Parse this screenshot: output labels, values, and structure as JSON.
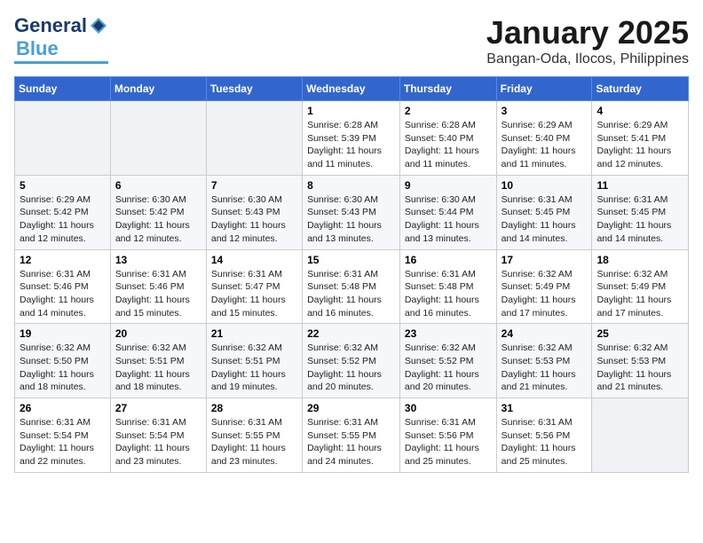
{
  "header": {
    "logo_line1": "General",
    "logo_line2": "Blue",
    "month": "January 2025",
    "location": "Bangan-Oda, Ilocos, Philippines"
  },
  "weekdays": [
    "Sunday",
    "Monday",
    "Tuesday",
    "Wednesday",
    "Thursday",
    "Friday",
    "Saturday"
  ],
  "weeks": [
    [
      {
        "day": "",
        "sunrise": "",
        "sunset": "",
        "daylight": ""
      },
      {
        "day": "",
        "sunrise": "",
        "sunset": "",
        "daylight": ""
      },
      {
        "day": "",
        "sunrise": "",
        "sunset": "",
        "daylight": ""
      },
      {
        "day": "1",
        "sunrise": "Sunrise: 6:28 AM",
        "sunset": "Sunset: 5:39 PM",
        "daylight": "Daylight: 11 hours and 11 minutes."
      },
      {
        "day": "2",
        "sunrise": "Sunrise: 6:28 AM",
        "sunset": "Sunset: 5:40 PM",
        "daylight": "Daylight: 11 hours and 11 minutes."
      },
      {
        "day": "3",
        "sunrise": "Sunrise: 6:29 AM",
        "sunset": "Sunset: 5:40 PM",
        "daylight": "Daylight: 11 hours and 11 minutes."
      },
      {
        "day": "4",
        "sunrise": "Sunrise: 6:29 AM",
        "sunset": "Sunset: 5:41 PM",
        "daylight": "Daylight: 11 hours and 12 minutes."
      }
    ],
    [
      {
        "day": "5",
        "sunrise": "Sunrise: 6:29 AM",
        "sunset": "Sunset: 5:42 PM",
        "daylight": "Daylight: 11 hours and 12 minutes."
      },
      {
        "day": "6",
        "sunrise": "Sunrise: 6:30 AM",
        "sunset": "Sunset: 5:42 PM",
        "daylight": "Daylight: 11 hours and 12 minutes."
      },
      {
        "day": "7",
        "sunrise": "Sunrise: 6:30 AM",
        "sunset": "Sunset: 5:43 PM",
        "daylight": "Daylight: 11 hours and 12 minutes."
      },
      {
        "day": "8",
        "sunrise": "Sunrise: 6:30 AM",
        "sunset": "Sunset: 5:43 PM",
        "daylight": "Daylight: 11 hours and 13 minutes."
      },
      {
        "day": "9",
        "sunrise": "Sunrise: 6:30 AM",
        "sunset": "Sunset: 5:44 PM",
        "daylight": "Daylight: 11 hours and 13 minutes."
      },
      {
        "day": "10",
        "sunrise": "Sunrise: 6:31 AM",
        "sunset": "Sunset: 5:45 PM",
        "daylight": "Daylight: 11 hours and 14 minutes."
      },
      {
        "day": "11",
        "sunrise": "Sunrise: 6:31 AM",
        "sunset": "Sunset: 5:45 PM",
        "daylight": "Daylight: 11 hours and 14 minutes."
      }
    ],
    [
      {
        "day": "12",
        "sunrise": "Sunrise: 6:31 AM",
        "sunset": "Sunset: 5:46 PM",
        "daylight": "Daylight: 11 hours and 14 minutes."
      },
      {
        "day": "13",
        "sunrise": "Sunrise: 6:31 AM",
        "sunset": "Sunset: 5:46 PM",
        "daylight": "Daylight: 11 hours and 15 minutes."
      },
      {
        "day": "14",
        "sunrise": "Sunrise: 6:31 AM",
        "sunset": "Sunset: 5:47 PM",
        "daylight": "Daylight: 11 hours and 15 minutes."
      },
      {
        "day": "15",
        "sunrise": "Sunrise: 6:31 AM",
        "sunset": "Sunset: 5:48 PM",
        "daylight": "Daylight: 11 hours and 16 minutes."
      },
      {
        "day": "16",
        "sunrise": "Sunrise: 6:31 AM",
        "sunset": "Sunset: 5:48 PM",
        "daylight": "Daylight: 11 hours and 16 minutes."
      },
      {
        "day": "17",
        "sunrise": "Sunrise: 6:32 AM",
        "sunset": "Sunset: 5:49 PM",
        "daylight": "Daylight: 11 hours and 17 minutes."
      },
      {
        "day": "18",
        "sunrise": "Sunrise: 6:32 AM",
        "sunset": "Sunset: 5:49 PM",
        "daylight": "Daylight: 11 hours and 17 minutes."
      }
    ],
    [
      {
        "day": "19",
        "sunrise": "Sunrise: 6:32 AM",
        "sunset": "Sunset: 5:50 PM",
        "daylight": "Daylight: 11 hours and 18 minutes."
      },
      {
        "day": "20",
        "sunrise": "Sunrise: 6:32 AM",
        "sunset": "Sunset: 5:51 PM",
        "daylight": "Daylight: 11 hours and 18 minutes."
      },
      {
        "day": "21",
        "sunrise": "Sunrise: 6:32 AM",
        "sunset": "Sunset: 5:51 PM",
        "daylight": "Daylight: 11 hours and 19 minutes."
      },
      {
        "day": "22",
        "sunrise": "Sunrise: 6:32 AM",
        "sunset": "Sunset: 5:52 PM",
        "daylight": "Daylight: 11 hours and 20 minutes."
      },
      {
        "day": "23",
        "sunrise": "Sunrise: 6:32 AM",
        "sunset": "Sunset: 5:52 PM",
        "daylight": "Daylight: 11 hours and 20 minutes."
      },
      {
        "day": "24",
        "sunrise": "Sunrise: 6:32 AM",
        "sunset": "Sunset: 5:53 PM",
        "daylight": "Daylight: 11 hours and 21 minutes."
      },
      {
        "day": "25",
        "sunrise": "Sunrise: 6:32 AM",
        "sunset": "Sunset: 5:53 PM",
        "daylight": "Daylight: 11 hours and 21 minutes."
      }
    ],
    [
      {
        "day": "26",
        "sunrise": "Sunrise: 6:31 AM",
        "sunset": "Sunset: 5:54 PM",
        "daylight": "Daylight: 11 hours and 22 minutes."
      },
      {
        "day": "27",
        "sunrise": "Sunrise: 6:31 AM",
        "sunset": "Sunset: 5:54 PM",
        "daylight": "Daylight: 11 hours and 23 minutes."
      },
      {
        "day": "28",
        "sunrise": "Sunrise: 6:31 AM",
        "sunset": "Sunset: 5:55 PM",
        "daylight": "Daylight: 11 hours and 23 minutes."
      },
      {
        "day": "29",
        "sunrise": "Sunrise: 6:31 AM",
        "sunset": "Sunset: 5:55 PM",
        "daylight": "Daylight: 11 hours and 24 minutes."
      },
      {
        "day": "30",
        "sunrise": "Sunrise: 6:31 AM",
        "sunset": "Sunset: 5:56 PM",
        "daylight": "Daylight: 11 hours and 25 minutes."
      },
      {
        "day": "31",
        "sunrise": "Sunrise: 6:31 AM",
        "sunset": "Sunset: 5:56 PM",
        "daylight": "Daylight: 11 hours and 25 minutes."
      },
      {
        "day": "",
        "sunrise": "",
        "sunset": "",
        "daylight": ""
      }
    ]
  ]
}
